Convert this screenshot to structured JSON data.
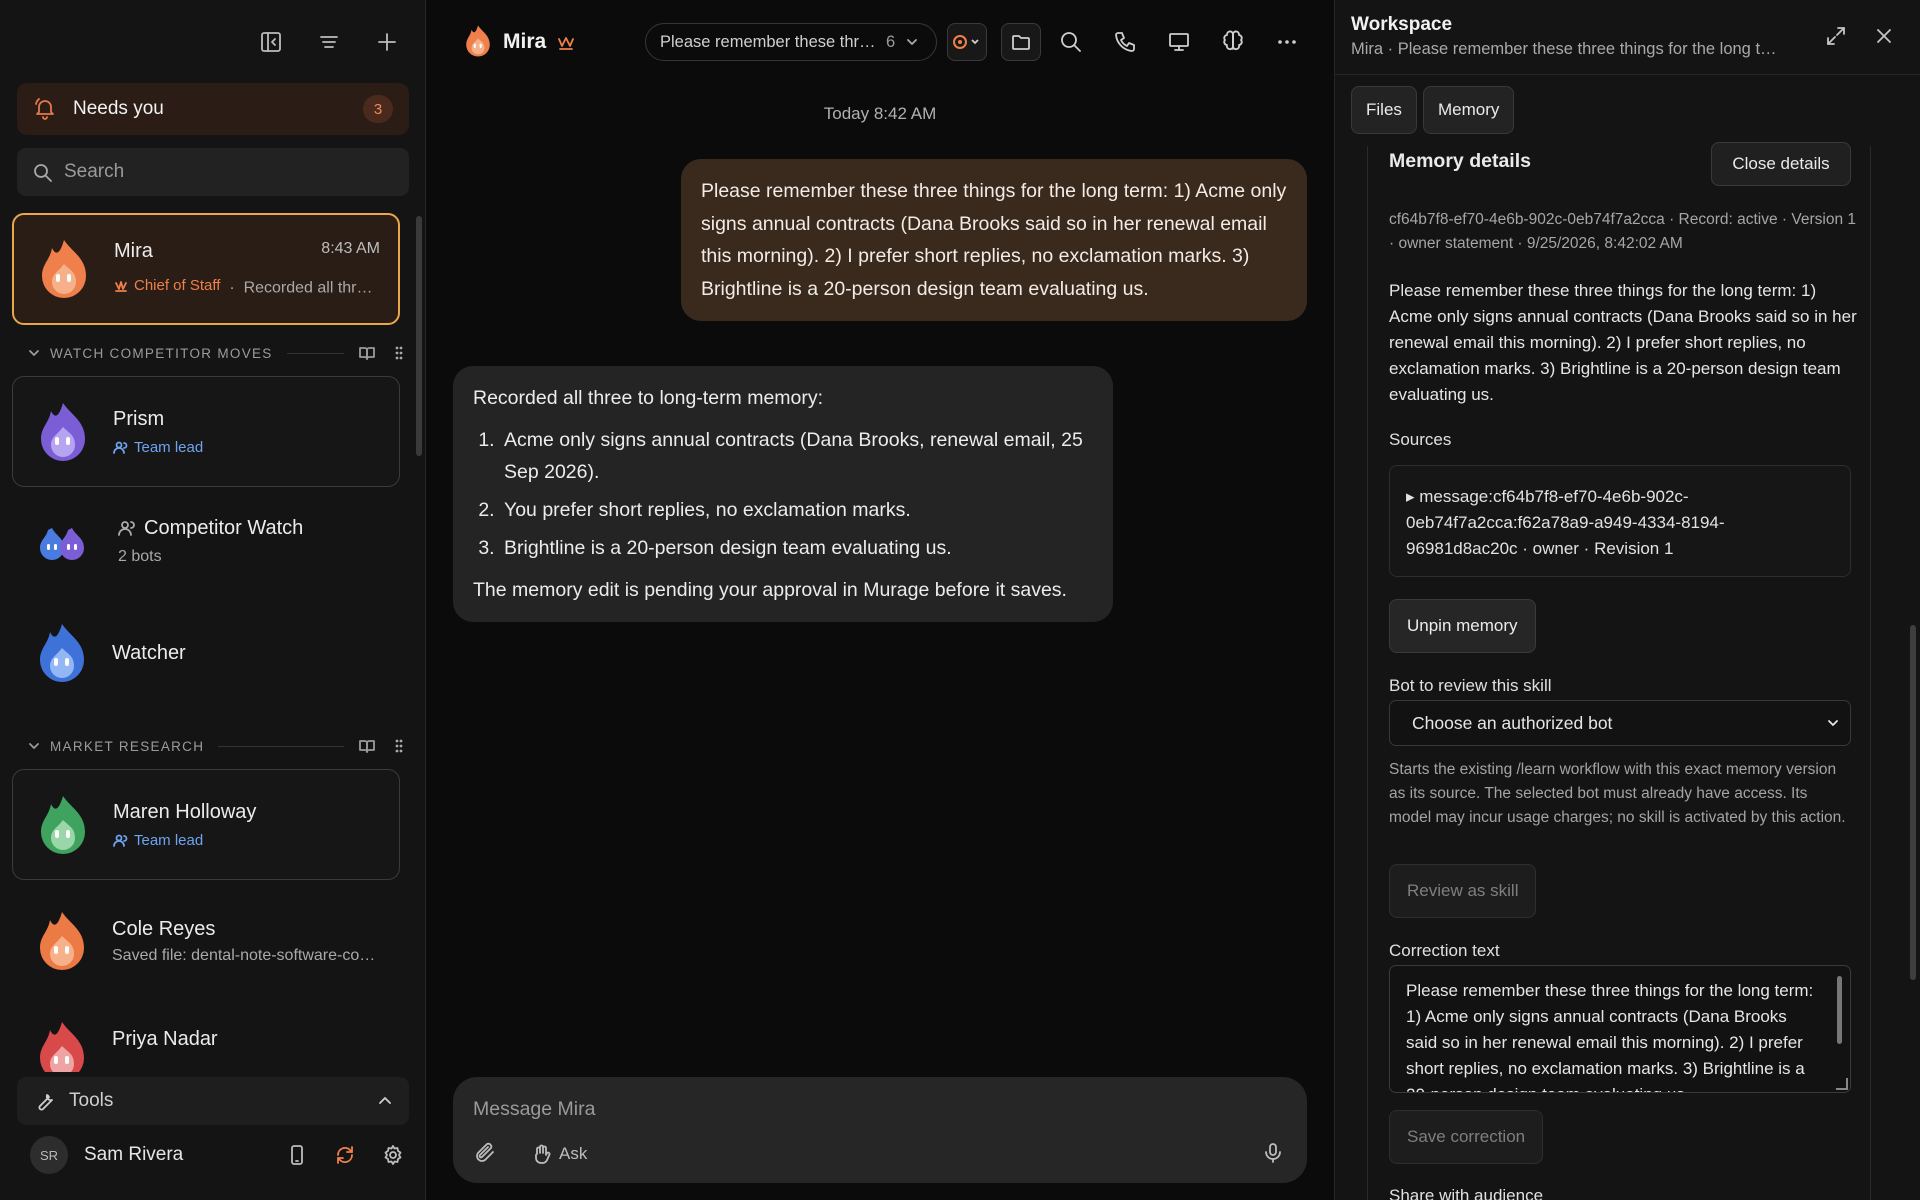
{
  "sidebar": {
    "needs_you": {
      "label": "Needs you",
      "count": "3"
    },
    "search_placeholder": "Search",
    "chats": [
      {
        "name": "Mira",
        "time": "8:43 AM",
        "role": "Chief of Staff",
        "preview": "Recorded all three to long-term memory"
      },
      {
        "name": "Prism",
        "role": "Team lead"
      },
      {
        "name": "Competitor Watch",
        "preview": "2 bots"
      },
      {
        "name": "Watcher"
      },
      {
        "name": "Maren Holloway",
        "role": "Team lead"
      },
      {
        "name": "Cole Reyes",
        "preview": "Saved file: dental-note-software-comparison"
      },
      {
        "name": "Priya Nadar"
      }
    ],
    "sections": [
      "WATCH COMPETITOR MOVES",
      "MARKET RESEARCH"
    ],
    "tools_label": "Tools",
    "user": {
      "initials": "SR",
      "name": "Sam Rivera"
    }
  },
  "chat": {
    "bot_name": "Mira",
    "thread_title": "Please remember these three things for the long term",
    "thread_count": "6",
    "day_stamp": "Today 8:42 AM",
    "user_message": "Please remember these three things for the long term: 1) Acme only signs annual contracts (Dana Brooks said so in her renewal email this morning). 2) I prefer short replies, no exclamation marks. 3) Brightline is a 20-person design team evaluating us.",
    "bot_reply": {
      "intro": "Recorded all three to long-term memory:",
      "items": [
        "Acme only signs annual contracts (Dana Brooks, renewal email, 25 Sep 2026).",
        "You prefer short replies, no exclamation marks.",
        "Brightline is a 20-person design team evaluating us."
      ],
      "outro": "The memory edit is pending your approval in Murage before it saves."
    },
    "composer_placeholder": "Message Mira",
    "ask_label": "Ask"
  },
  "panel": {
    "title": "Workspace",
    "subtitle": "Mira · Please remember these three things for the long term",
    "tabs": [
      "Files",
      "Memory"
    ],
    "details": {
      "title": "Memory details",
      "close_label": "Close details",
      "meta": "cf64b7f8-ef70-4e6b-902c-0eb74f7a2cca · Record: active · Version 1 · owner statement · 9/25/2026, 8:42:02 AM",
      "text": "Please remember these three things for the long term: 1) Acme only signs annual contracts (Dana Brooks said so in her renewal email this morning). 2) I prefer short replies, no exclamation marks. 3) Brightline is a 20-person design team evaluating us.",
      "sources_label": "Sources",
      "source": "▸ message:cf64b7f8-ef70-4e6b-902c-0eb74f7a2cca:f62a78a9-a949-4334-8194-96981d8ac20c · owner · Revision 1",
      "unpin_label": "Unpin memory",
      "bot_review_label": "Bot to review this skill",
      "bot_select_value": "Choose an authorized bot",
      "help": "Starts the existing /learn workflow with this exact memory version as its source. The selected bot must already have access. Its model may incur usage charges; no skill is activated by this action.",
      "review_label": "Review as skill",
      "correction_label": "Correction text",
      "correction_value": "Please remember these three things for the long term: 1) Acme only signs annual contracts (Dana Brooks said so in her renewal email this morning). 2) I prefer short replies, no exclamation marks. 3) Brightline is a 20-person design team evaluating us.",
      "save_label": "Save correction",
      "share_label": "Share with audience"
    }
  },
  "colors": {
    "accent": "#e5784a",
    "selected_border": "#e9a74a",
    "team_lead": "#6ea3ef"
  }
}
